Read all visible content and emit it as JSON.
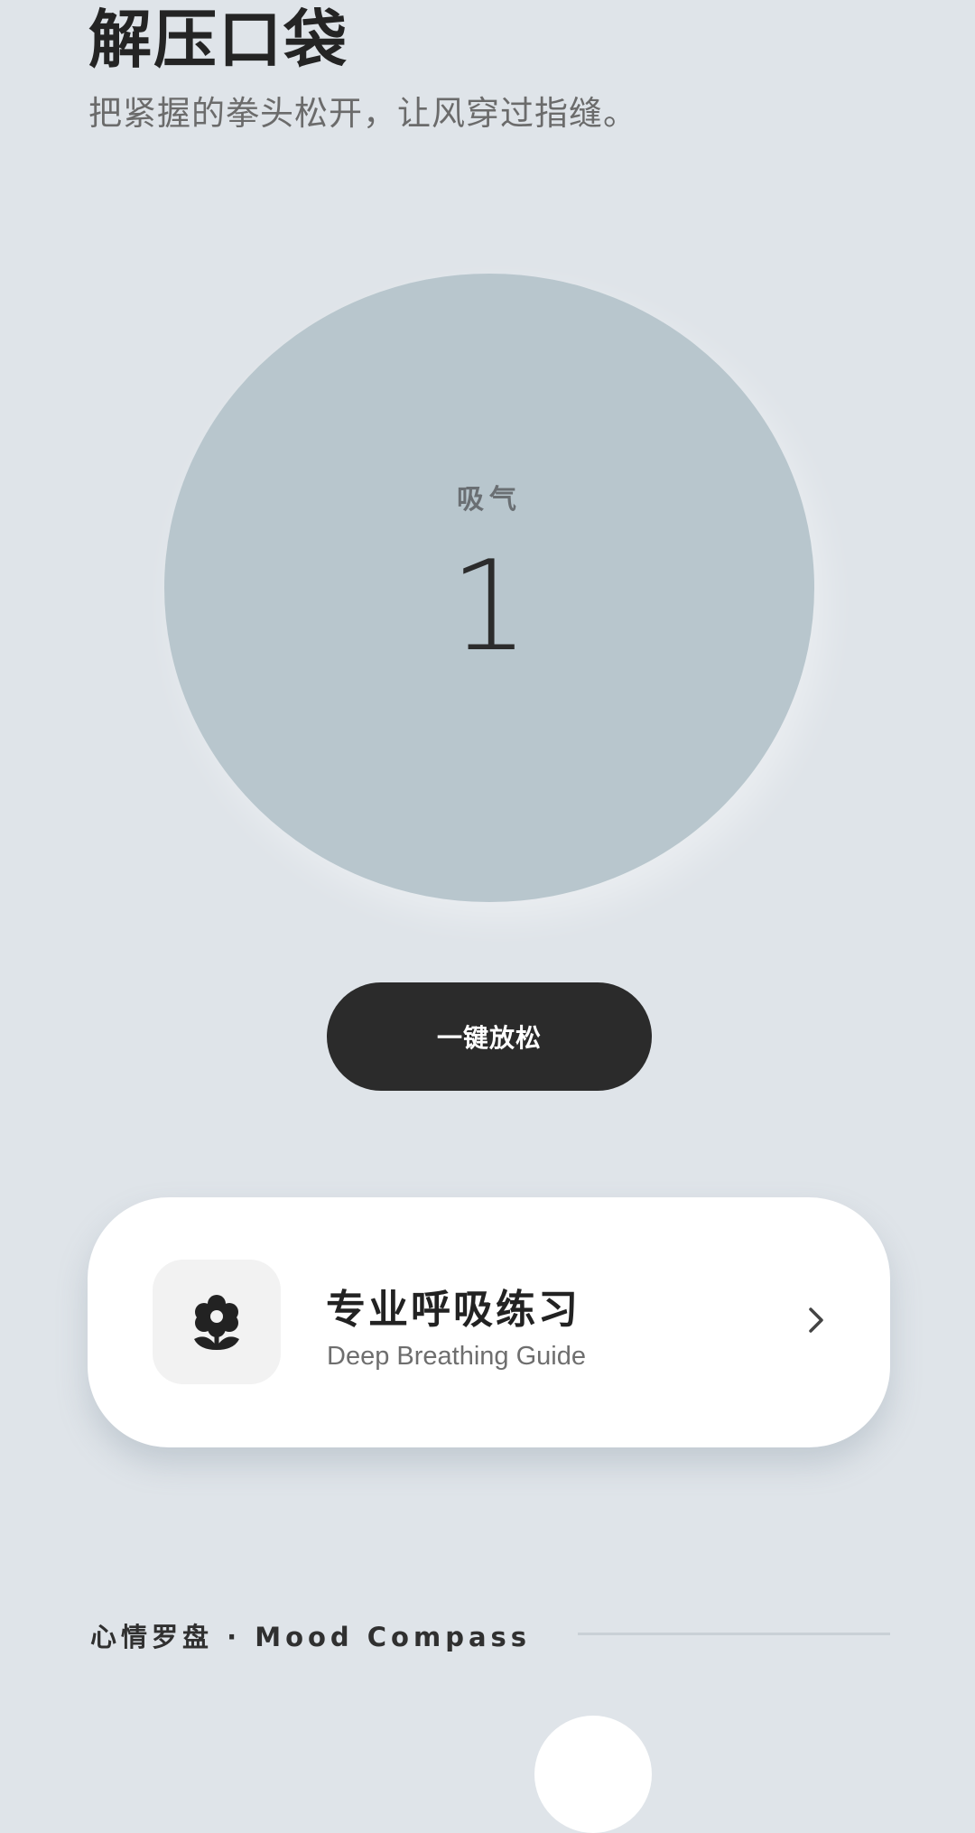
{
  "header": {
    "title": "解压口袋",
    "subtitle": "把紧握的拳头松开，让风穿过指缝。"
  },
  "breathing": {
    "phase": "吸气",
    "count": "1"
  },
  "actions": {
    "relax_label": "一键放松"
  },
  "breathing_card": {
    "title": "专业呼吸练习",
    "subtitle": "Deep Breathing Guide",
    "icon": "flower-icon",
    "chevron_icon": "chevron-right-icon"
  },
  "mood_section": {
    "label": "心情罗盘 · Mood Compass"
  },
  "colors": {
    "background": "#dfe4e9",
    "circle": "#b8c6cd",
    "button": "#2b2b2b",
    "card": "#ffffff"
  }
}
